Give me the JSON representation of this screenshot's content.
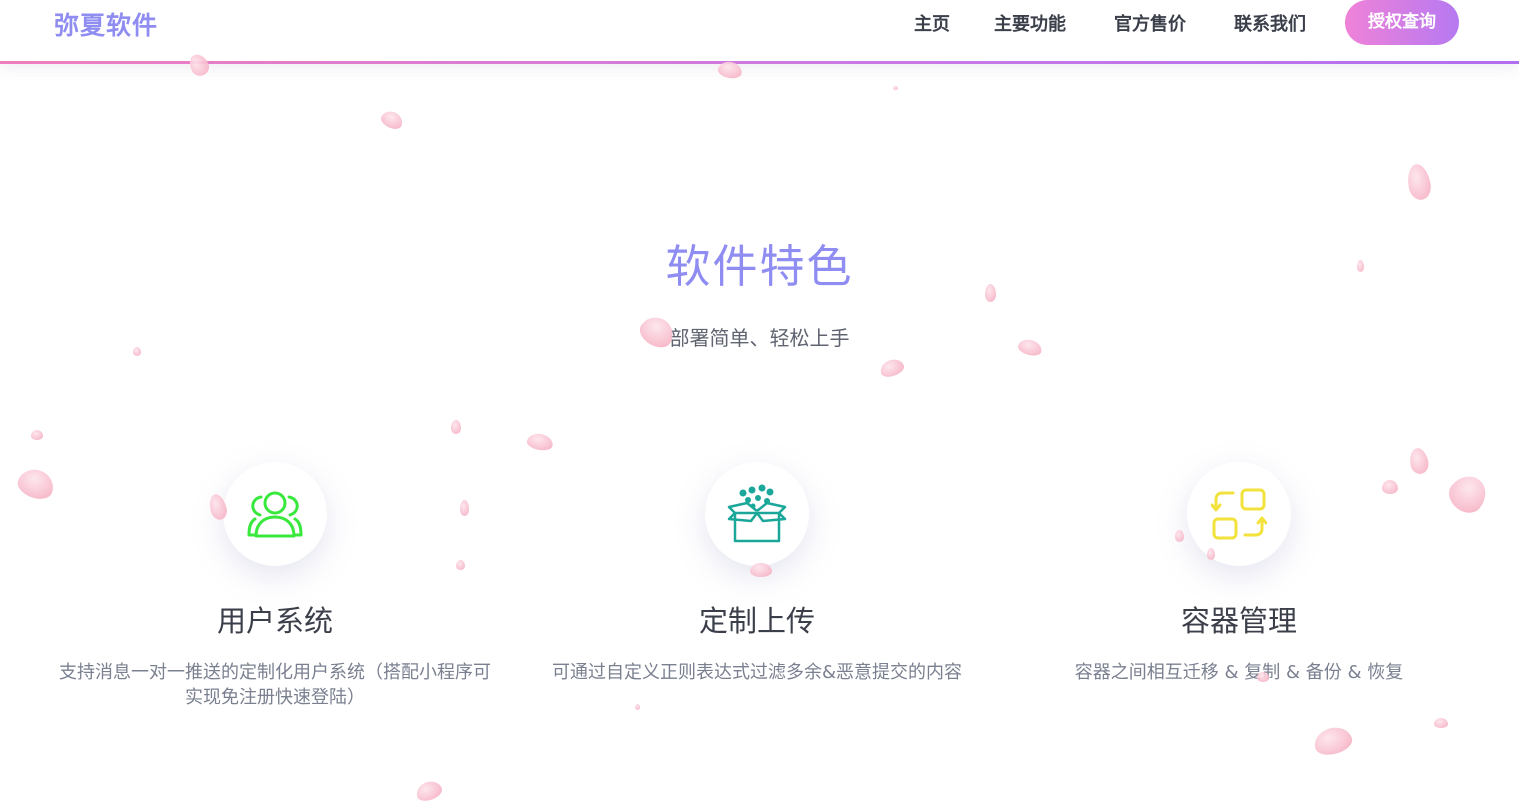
{
  "header": {
    "brand": "弥夏软件",
    "nav": [
      "主页",
      "主要功能",
      "官方售价",
      "联系我们"
    ],
    "cta": "授权查询"
  },
  "section": {
    "title": "软件特色",
    "subtitle": "部署简单、轻松上手"
  },
  "features": [
    {
      "icon": "users-icon",
      "color": "#39e83d",
      "title": "用户系统",
      "desc": "支持消息一对一推送的定制化用户系统（搭配小程序可实现免注册快速登陆）"
    },
    {
      "icon": "box-upload-icon",
      "color": "#1aa79a",
      "title": "定制上传",
      "desc": "可通过自定义正则表达式过滤多余&恶意提交的内容"
    },
    {
      "icon": "container-swap-icon",
      "color": "#f2e23b",
      "title": "容器管理",
      "desc": "容器之间相互迁移 & 复制 & 备份 & 恢复"
    }
  ],
  "colors": {
    "brand": "#8f8df2",
    "cta_gradient_start": "#ef82d8",
    "cta_gradient_end": "#b679f1",
    "petal": "#f7b8c9"
  }
}
